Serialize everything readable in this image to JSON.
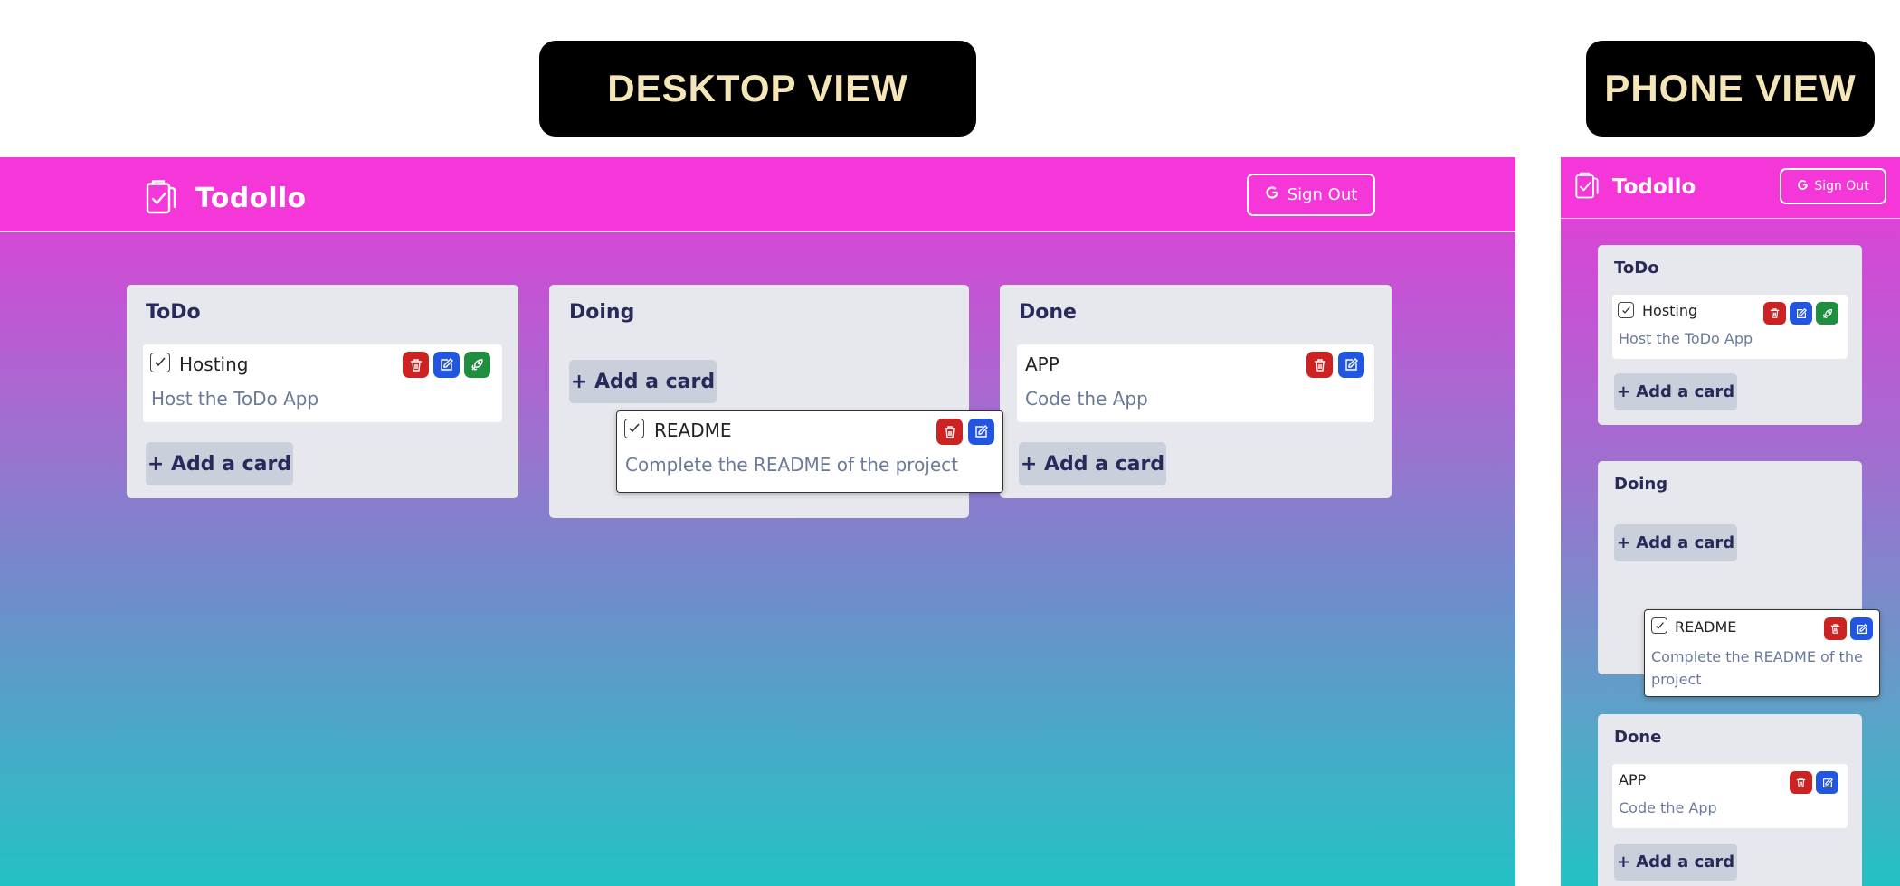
{
  "labels": {
    "desktop_view": "DESKTOP VIEW",
    "phone_view": "PHONE VIEW"
  },
  "app": {
    "name": "Todollo",
    "sign_out": "Sign Out"
  },
  "columns": [
    {
      "title": "ToDo",
      "cards": [
        {
          "title": "Hosting",
          "description": "Host the ToDo App",
          "actions": [
            "delete",
            "edit",
            "deploy"
          ]
        }
      ]
    },
    {
      "title": "Doing",
      "cards": [
        {
          "title": "README",
          "description": "Complete the README of the project",
          "actions": [
            "delete",
            "edit"
          ],
          "state": "dragging"
        }
      ]
    },
    {
      "title": "Done",
      "cards": [
        {
          "title": "APP",
          "description": "Code the App",
          "actions": [
            "delete",
            "edit"
          ]
        }
      ]
    }
  ],
  "add_card_label": "+ Add a card",
  "colors": {
    "header": "#f536d9",
    "gradient_top": "#f336da",
    "gradient_bottom": "#22c1c3",
    "delete": "#cc2222",
    "edit": "#2356e0",
    "deploy": "#1f8e3e",
    "column_bg": "#e6e8ee"
  },
  "icons": [
    "clipboard-check-icon",
    "google-icon",
    "trash-icon",
    "edit-icon",
    "rocket-icon",
    "checkbox-icon"
  ]
}
